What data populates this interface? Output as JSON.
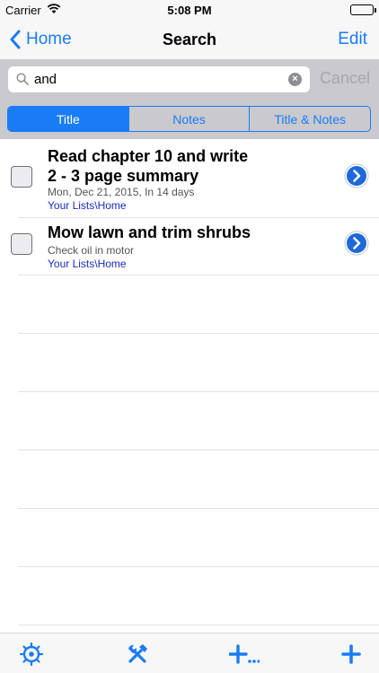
{
  "status_bar": {
    "carrier": "Carrier",
    "time": "5:08 PM"
  },
  "nav": {
    "back_label": "Home",
    "title": "Search",
    "edit_label": "Edit"
  },
  "search": {
    "query": "and",
    "cancel_label": "Cancel"
  },
  "scope": {
    "segments": [
      "Title",
      "Notes",
      "Title & Notes"
    ],
    "selected": "Title"
  },
  "tasks": [
    {
      "title_line1": "Read chapter 10 and write",
      "title_line2": "2 - 3 page summary",
      "subtitle": "Mon, Dec 21, 2015, In 14 days",
      "path": "Your Lists\\Home"
    },
    {
      "title_line1": "Mow lawn and trim shrubs",
      "subtitle": "Check oil in motor",
      "path": "Your Lists\\Home"
    }
  ],
  "toolbar": {
    "icons": [
      "ship-wheel-icon",
      "tools-icon",
      "add-more-icon",
      "add-icon"
    ]
  },
  "colors": {
    "accent": "#1a7cf4",
    "path_link": "#1b2bc1",
    "search_background": "#c9c9ce"
  }
}
